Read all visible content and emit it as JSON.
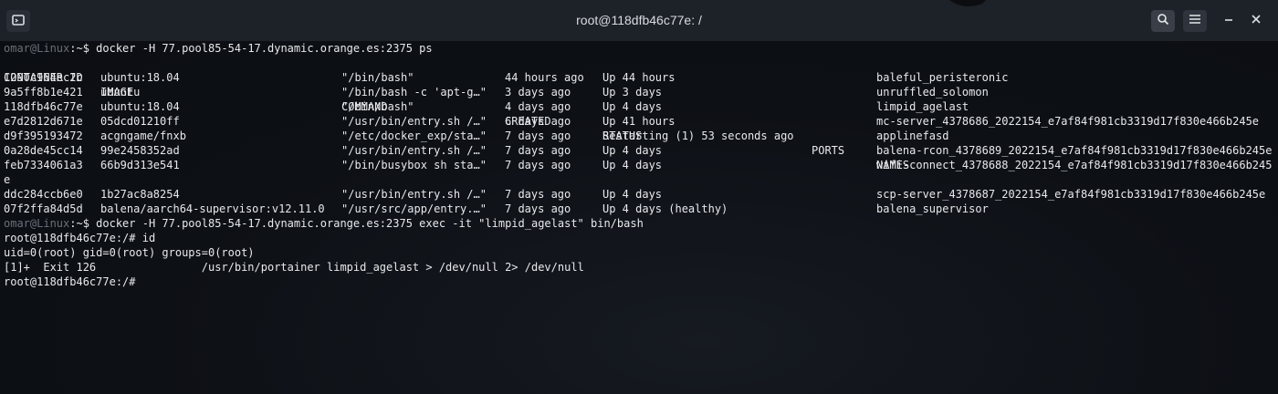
{
  "title": "root@118dfb46c77e: /",
  "colors": {
    "titlebar": "#1d2128",
    "background": "#0d1015",
    "text": "#e7e9ec"
  },
  "icons": {
    "left": "new-tab-icon",
    "search": "search-icon",
    "menu": "hamburger-menu-icon",
    "minimize": "minimize-icon",
    "close": "close-icon"
  },
  "lines": {
    "l0": {
      "user": "omar@Linux",
      "rest": ":~$ docker -H 77.pool85-54-17.dynamic.orange.es:2375 ps"
    },
    "l2": {
      "user": "omar@Linux",
      "rest": ":~$ docker -H 77.pool85-54-17.dynamic.orange.es:2375 exec -it \"limpid_agelast\" bin/bash"
    },
    "l3": "root@118dfb46c77e:/# id",
    "l4": "uid=0(root) gid=0(root) groups=0(root)",
    "l5": "[1]+  Exit 126                /usr/bin/portainer limpid_agelast > /dev/null 2> /dev/null",
    "l6": "root@118dfb46c77e:/#"
  },
  "ps": {
    "headers": {
      "id": "CONTAINER ID",
      "image": "IMAGE",
      "command": "COMMAND",
      "created": "CREATED",
      "status": "STATUS",
      "ports": "PORTS",
      "names": "NAMES"
    },
    "rows": [
      {
        "id": "1290c964ec2c",
        "image": "ubuntu:18.04",
        "command": "\"/bin/bash\"",
        "created": "44 hours ago",
        "status": "Up 44 hours",
        "names": "baleful_peristeronic"
      },
      {
        "id": "9a5ff8b1e421",
        "image": "ubuntu",
        "command": "\"/bin/bash -c 'apt-g…\"",
        "created": "3 days ago",
        "status": "Up 3 days",
        "names": "unruffled_solomon"
      },
      {
        "id": "118dfb46c77e",
        "image": "ubuntu:18.04",
        "command": "\"/bin/bash\"",
        "created": "4 days ago",
        "status": "Up 4 days",
        "names": "limpid_agelast"
      },
      {
        "id": "e7d2812d671e",
        "image": "05dcd01210ff",
        "command": "\"/usr/bin/entry.sh /…\"",
        "created": "6 days ago",
        "status": "Up 41 hours",
        "names": "mc-server_4378686_2022154_e7af84f981cb3319d17f830e466b245e"
      },
      {
        "id": "d9f395193472",
        "image": "acgngame/fnxb",
        "command": "\"/etc/docker_exp/sta…\"",
        "created": "7 days ago",
        "status": "Restarting (1) 53 seconds ago",
        "names": "applinefasd"
      },
      {
        "id": "0a28de45cc14",
        "image": "99e2458352ad",
        "command": "\"/usr/bin/entry.sh /…\"",
        "created": "7 days ago",
        "status": "Up 4 days",
        "names": "balena-rcon_4378689_2022154_e7af84f981cb3319d17f830e466b245e"
      },
      {
        "id": "feb7334061a3",
        "image": "66b9d313e541",
        "command": "\"/bin/busybox sh sta…\"",
        "created": "7 days ago",
        "status": "Up 4 days",
        "names": "wifi-connect_4378688_2022154_e7af84f981cb3319d17f830e466b245"
      },
      {
        "wrap": "e"
      },
      {
        "id": "ddc284ccb6e0",
        "image": "1b27ac8a8254",
        "command": "\"/usr/bin/entry.sh /…\"",
        "created": "7 days ago",
        "status": "Up 4 days",
        "names": "scp-server_4378687_2022154_e7af84f981cb3319d17f830e466b245e"
      },
      {
        "id": "07f2ffa84d5d",
        "image": "balena/aarch64-supervisor:v12.11.0",
        "command": "\"/usr/src/app/entry.…\"",
        "created": "7 days ago",
        "status": "Up 4 days (healthy)",
        "names": "balena_supervisor"
      }
    ]
  }
}
